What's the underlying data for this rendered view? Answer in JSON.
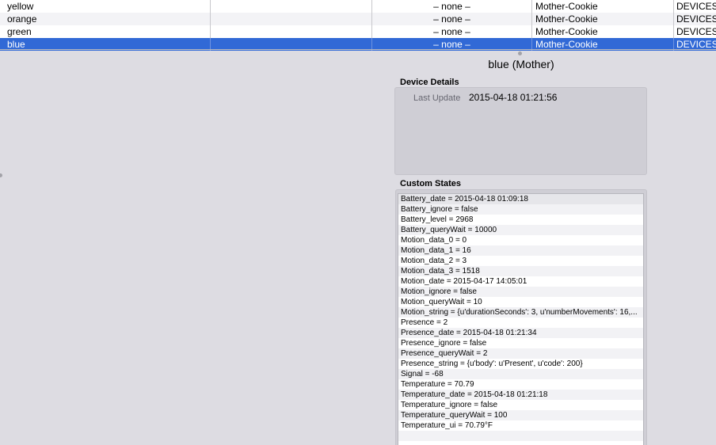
{
  "device_table": {
    "rows": [
      {
        "name": "yellow",
        "state": "– none –",
        "folder": "Mother-Cookie",
        "type": "DEVICES"
      },
      {
        "name": "orange",
        "state": "– none –",
        "folder": "Mother-Cookie",
        "type": "DEVICES"
      },
      {
        "name": "green",
        "state": "– none –",
        "folder": "Mother-Cookie",
        "type": "DEVICES"
      },
      {
        "name": "blue",
        "state": "– none –",
        "folder": "Mother-Cookie",
        "type": "DEVICES"
      }
    ]
  },
  "detail": {
    "device_title": "blue (Mother)",
    "details_heading": "Device Details",
    "last_update_label": "Last Update",
    "last_update_value": "2015-04-18 01:21:56",
    "custom_states_heading": "Custom States",
    "custom_states": [
      "Battery_date = 2015-04-18 01:09:18",
      "Battery_ignore = false",
      "Battery_level = 2968",
      "Battery_queryWait = 10000",
      "Motion_data_0 = 0",
      "Motion_data_1 = 16",
      "Motion_data_2 = 3",
      "Motion_data_3 = 1518",
      "Motion_date = 2015-04-17 14:05:01",
      "Motion_ignore = false",
      "Motion_queryWait = 10",
      "Motion_string = {u'durationSeconds': 3, u'numberMovements': 16,...",
      "Presence = 2",
      "Presence_date = 2015-04-18 01:21:34",
      "Presence_ignore = false",
      "Presence_queryWait = 2",
      "Presence_string = {u'body': u'Present', u'code': 200}",
      "Signal = -68",
      "Temperature = 70.79",
      "Temperature_date = 2015-04-18 01:21:18",
      "Temperature_ignore = false",
      "Temperature_queryWait = 100",
      "Temperature_ui = 70.79°F",
      "",
      ""
    ]
  },
  "colors": {
    "selection": "#3169d6",
    "background": "#dddce2"
  }
}
